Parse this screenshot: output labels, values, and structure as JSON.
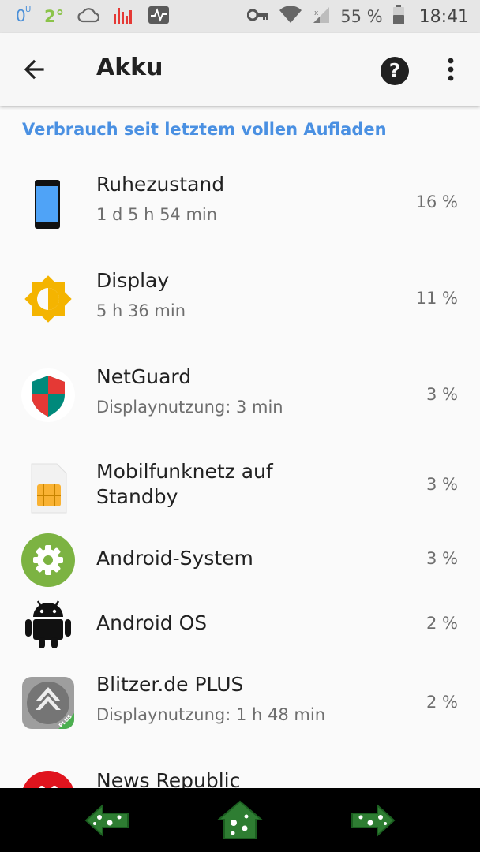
{
  "status_bar": {
    "icons_left": [
      "vpn-usage-icon",
      "temperature-icon",
      "cloud-icon",
      "signal-bars-app-icon",
      "activity-monitor-icon"
    ],
    "temp_text": "2°",
    "battery_percent": "55 %",
    "time": "18:41"
  },
  "app_bar": {
    "title": "Akku",
    "help_glyph": "?"
  },
  "section_title": "Verbrauch seit letztem vollen Aufladen",
  "items": [
    {
      "label": "Ruhezustand",
      "sub": "1 d 5 h 54 min",
      "percent": "16 %",
      "icon": "phone-icon"
    },
    {
      "label": "Display",
      "sub": "5 h 36 min",
      "percent": "11 %",
      "icon": "brightness-icon"
    },
    {
      "label": "NetGuard",
      "sub": "Displaynutzung: 3 min",
      "percent": "3 %",
      "icon": "shield-icon"
    },
    {
      "label": "Mobilfunknetz auf Standby",
      "sub": "",
      "percent": "3 %",
      "icon": "sim-card-icon"
    },
    {
      "label": "Android-System",
      "sub": "",
      "percent": "3 %",
      "icon": "settings-gear-icon"
    },
    {
      "label": "Android OS",
      "sub": "",
      "percent": "2 %",
      "icon": "android-icon"
    },
    {
      "label": "Blitzer.de PLUS",
      "sub": "Displaynutzung: 1 h 48 min",
      "percent": "2 %",
      "icon": "blitzer-icon"
    },
    {
      "label": "News Republic",
      "sub": "",
      "percent": "",
      "icon": "news-republic-icon"
    }
  ],
  "blitzer_badge": "PLUS",
  "colors": {
    "accent": "#4a90e2",
    "nav_icon_green": "#2e7d32",
    "display_icon": "#f4b400",
    "android_system_green": "#7cb342"
  }
}
